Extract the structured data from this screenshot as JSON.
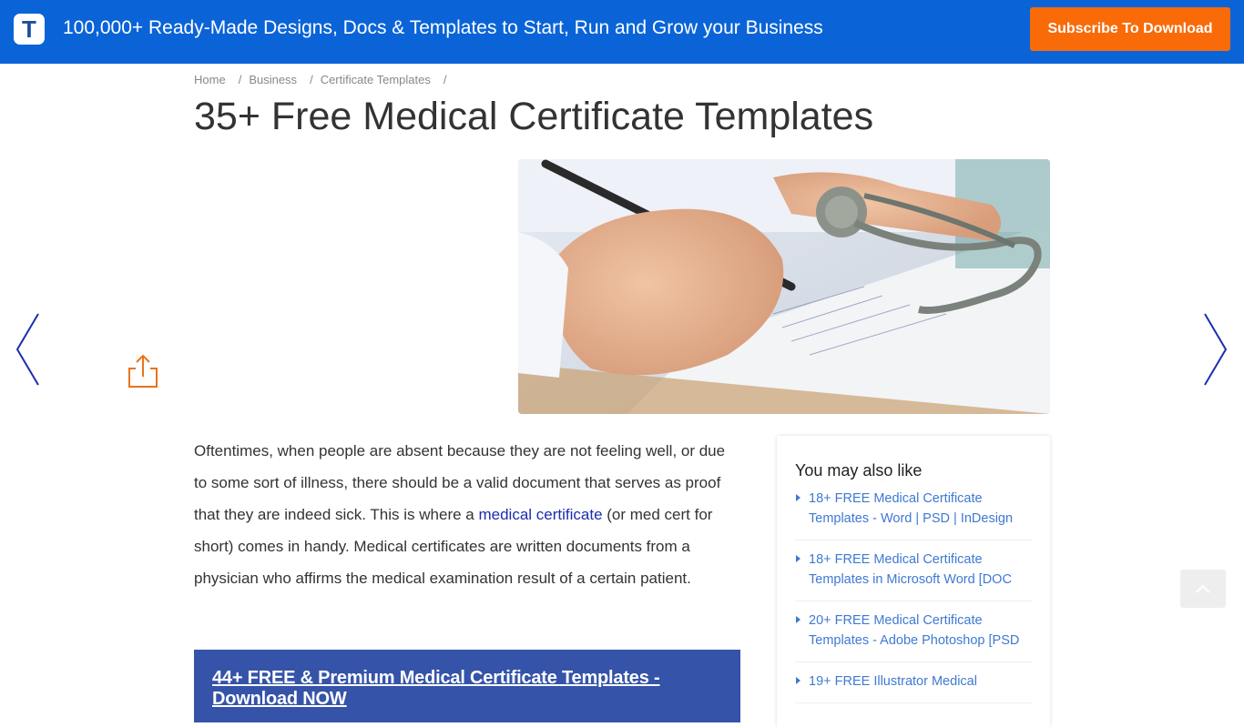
{
  "header": {
    "logo_letter": "T",
    "tagline": "100,000+ Ready-Made Designs, Docs & Templates to Start, Run and Grow your Business",
    "subscribe_label": "Subscribe To Download",
    "brand_color": "#0a64d8",
    "accent_color": "#f86b08"
  },
  "breadcrumb": {
    "items": [
      "Home",
      "Business",
      "Certificate Templates"
    ],
    "separator": "/"
  },
  "page": {
    "title": "35+ Free Medical Certificate Templates",
    "hero_alt": "Doctor writing on a medical certificate with stethoscope"
  },
  "article": {
    "p1_a": "Oftentimes, when people are absent because they are not feeling well, or due to some sort of illness, there should be a valid document that serves as proof that they are indeed sick. This is where a ",
    "p1_link": "medical certificate",
    "p1_b": " (or med cert for short) comes in handy. Medical certificates are written documents from a physician who affirms the medical examination result of a certain patient."
  },
  "cta": {
    "label": "44+ FREE & Premium Medical Certificate Templates - Download NOW"
  },
  "sidebar": {
    "heading": "You may also like",
    "items": [
      {
        "label": "18+ FREE Medical Certificate Templates - Word | PSD | InDesign"
      },
      {
        "label": "18+ FREE Medical Certificate Templates in Microsoft Word [DOC"
      },
      {
        "label": "20+ FREE Medical Certificate Templates - Adobe Photoshop [PSD"
      },
      {
        "label": "19+ FREE Illustrator Medical"
      }
    ]
  },
  "icons": {
    "share": "share-icon",
    "prev": "chevron-left-icon",
    "next": "chevron-right-icon",
    "scroll_top": "chevron-up-icon"
  }
}
